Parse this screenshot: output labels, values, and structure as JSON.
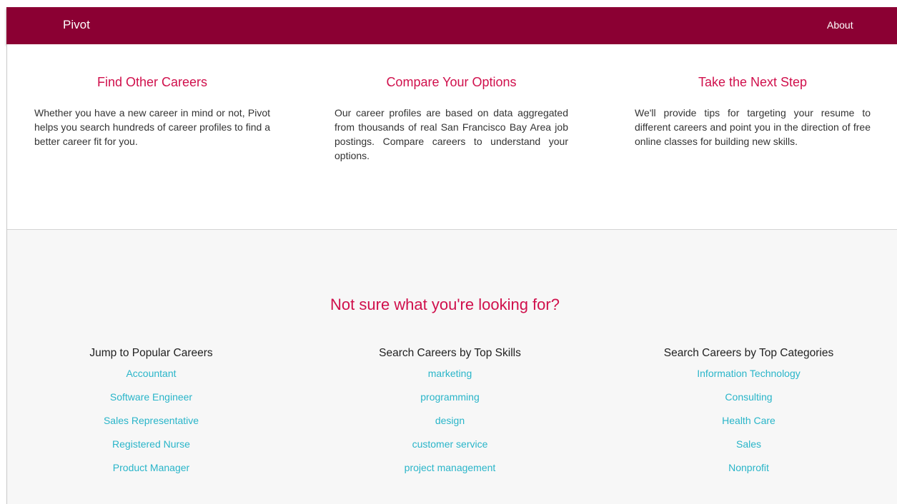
{
  "header": {
    "brand": "Pivot",
    "nav": {
      "about": "About"
    }
  },
  "features": [
    {
      "title": "Find Other Careers",
      "text": "Whether you have a new career in mind or not, Pivot helps you search hundreds of career profiles to find a better career fit for you."
    },
    {
      "title": "Compare Your Options",
      "text": "Our career profiles are based on data aggregated from thousands of real San Francisco Bay Area job postings. Compare careers to understand your options."
    },
    {
      "title": "Take the Next Step",
      "text": "We'll provide tips for targeting your resume to different careers and point you in the direction of free online classes for building new skills."
    }
  ],
  "explore": {
    "title": "Not sure what you're looking for?",
    "columns": [
      {
        "heading": "Jump to Popular Careers",
        "links": [
          "Accountant",
          "Software Engineer",
          "Sales Representative",
          "Registered Nurse",
          "Product Manager"
        ]
      },
      {
        "heading": "Search Careers by Top Skills",
        "links": [
          "marketing",
          "programming",
          "design",
          "customer service",
          "project management"
        ]
      },
      {
        "heading": "Search Careers by Top Categories",
        "links": [
          "Information Technology",
          "Consulting",
          "Health Care",
          "Sales",
          "Nonprofit"
        ]
      }
    ]
  },
  "colors": {
    "header_bg": "#8b0033",
    "accent_heading": "#d0104c",
    "link": "#29b5c9",
    "section_bg": "#f7f7f7"
  }
}
